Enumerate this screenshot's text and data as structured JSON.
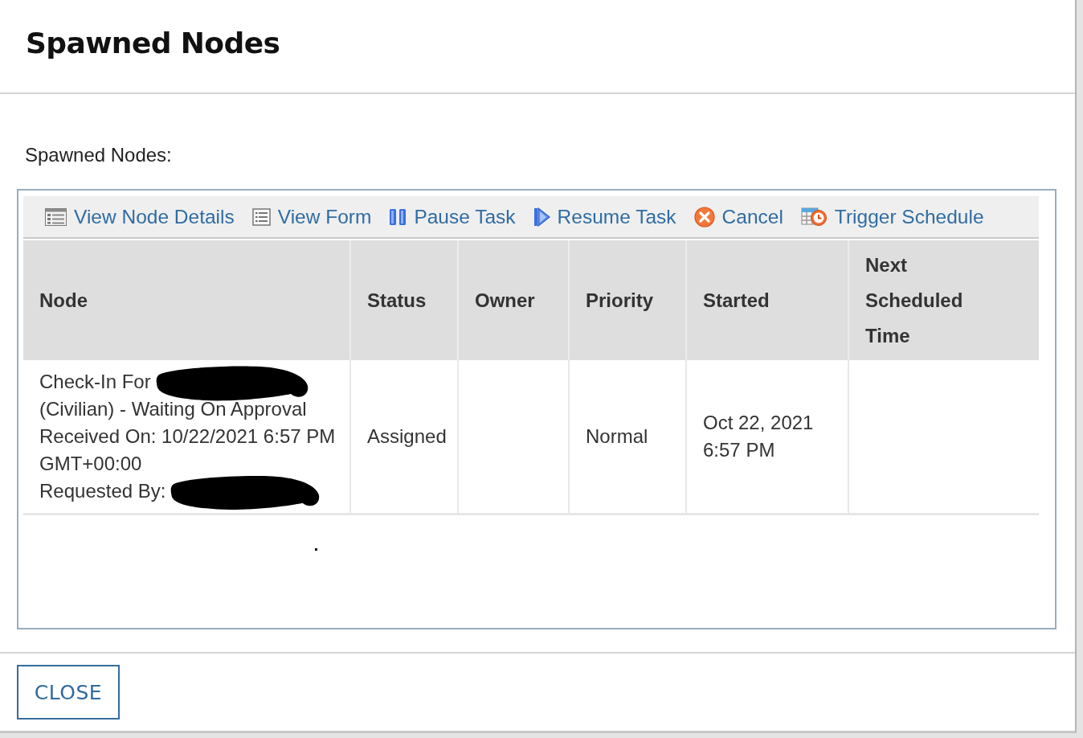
{
  "dialog": {
    "title": "Spawned Nodes",
    "section_label": "Spawned Nodes:"
  },
  "toolbar": [
    {
      "kind": "details",
      "label": "View Node Details"
    },
    {
      "kind": "form",
      "label": "View Form"
    },
    {
      "kind": "pause",
      "label": "Pause Task"
    },
    {
      "kind": "resume",
      "label": "Resume Task"
    },
    {
      "kind": "cancel",
      "label": "Cancel"
    },
    {
      "kind": "schedule",
      "label": "Trigger Schedule"
    }
  ],
  "table": {
    "columns": [
      "Node",
      "Status",
      "Owner",
      "Priority",
      "Started",
      "Next Scheduled Time"
    ],
    "rows": [
      {
        "node": [
          {
            "text": "Check-In For",
            "redacted": true
          },
          {
            "text": "(Civilian) - Waiting On Approval",
            "redacted": false
          },
          {
            "text": "Received On: 10/22/2021 6:57 PM",
            "redacted": false
          },
          {
            "text": "GMT+00:00",
            "redacted": false
          },
          {
            "text": "Requested By:",
            "redacted": true
          }
        ],
        "status": "Assigned",
        "priority": "Normal",
        "started": "Oct 22, 2021 6:57 PM"
      }
    ]
  },
  "footer": {
    "buttons": [
      "CLOSE"
    ]
  }
}
